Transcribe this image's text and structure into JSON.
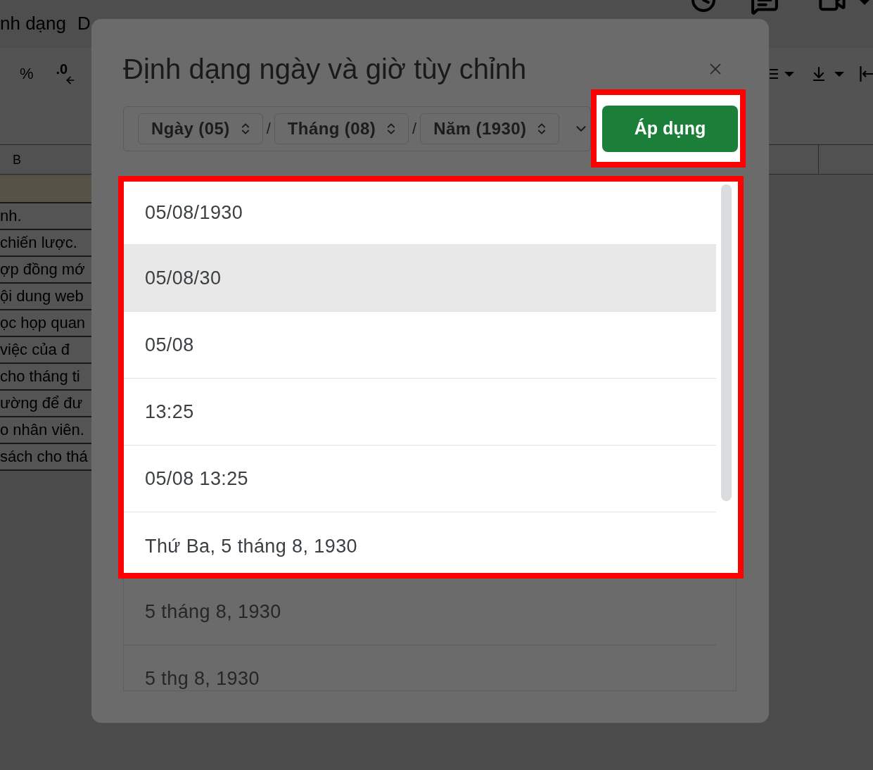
{
  "sheet": {
    "menu": [
      {
        "label": "nh dạng"
      },
      {
        "label": "D"
      }
    ],
    "toolbar": [
      {
        "kind": "text",
        "label": "%"
      },
      {
        "kind": "decimal",
        "label": ".0"
      }
    ],
    "column_header": "B",
    "cells": [
      "nh.",
      "chiến lược.",
      "ợp đồng mớ",
      "ội dung web",
      "ọc họp quan",
      "việc của đ",
      "cho tháng ti",
      "ường để đư",
      "o nhân viên.",
      "sách cho thá"
    ]
  },
  "dialog": {
    "title": "Định dạng ngày và giờ tùy chỉnh",
    "date_parts": [
      {
        "kind": "chip",
        "label": "Ngày (05)"
      },
      {
        "kind": "separator",
        "label": "/"
      },
      {
        "kind": "chip",
        "label": "Tháng (08)"
      },
      {
        "kind": "separator",
        "label": "/"
      },
      {
        "kind": "chip",
        "label": "Năm (1930)"
      }
    ],
    "apply_button": {
      "label": "Áp dụng",
      "highlighted": true
    },
    "formats": [
      {
        "label": "05/08/1930",
        "selected": false,
        "highlighted": true
      },
      {
        "label": "05/08/30",
        "selected": true,
        "highlighted": true
      },
      {
        "label": "05/08",
        "selected": false,
        "highlighted": true
      },
      {
        "label": "13:25",
        "selected": false,
        "highlighted": true
      },
      {
        "label": "05/08 13:25",
        "selected": false,
        "highlighted": true
      },
      {
        "label": "Thứ Ba, 5 tháng 8, 1930",
        "selected": false,
        "highlighted": true
      },
      {
        "label": "5 tháng 8, 1930",
        "selected": false,
        "highlighted": false
      },
      {
        "label": "5 thg 8, 1930",
        "selected": false,
        "highlighted": false
      }
    ]
  }
}
